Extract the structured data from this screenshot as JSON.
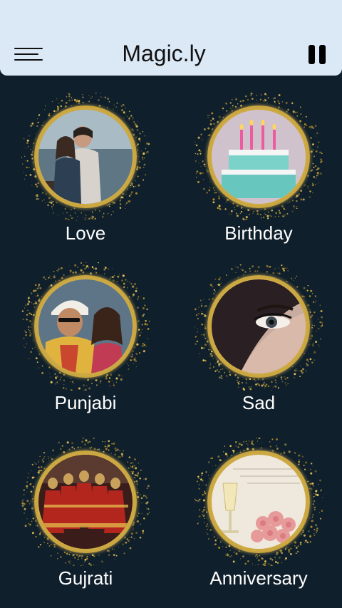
{
  "app_bar": {
    "title": "Magic.ly",
    "menu_icon": "menu-icon",
    "pause_icon": "pause-icon"
  },
  "colors": {
    "background": "#0f1f2b",
    "app_bar": "#dbe8f6",
    "gold_ring": "#e4c25a",
    "label_text": "#ffffff"
  },
  "categories": [
    {
      "label": "Love",
      "image": "couple-photo"
    },
    {
      "label": "Birthday",
      "image": "birthday-cake-photo"
    },
    {
      "label": "Punjabi",
      "image": "punjabi-couple-photo"
    },
    {
      "label": "Sad",
      "image": "sad-eye-photo"
    },
    {
      "label": "Gujrati",
      "image": "gujarati-dancers-photo"
    },
    {
      "label": "Anniversary",
      "image": "anniversary-champagne-photo"
    }
  ]
}
